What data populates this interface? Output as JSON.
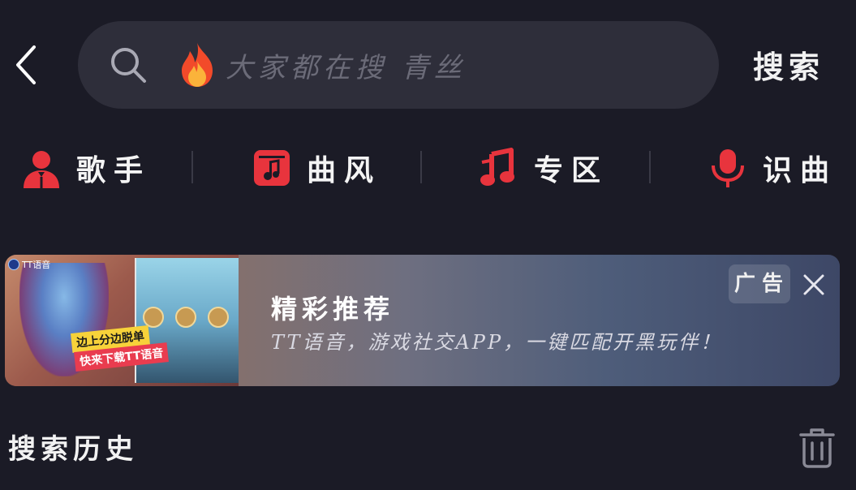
{
  "header": {
    "search_placeholder_prefix": "大家都在搜",
    "search_placeholder_keyword": "青丝",
    "search_button_label": "搜索",
    "icons": {
      "back": "chevron-left-icon",
      "search": "search-icon",
      "hot": "fire-icon"
    }
  },
  "categories": [
    {
      "label": "歌手",
      "icon": "singer-icon"
    },
    {
      "label": "曲风",
      "icon": "music-style-icon"
    },
    {
      "label": "专区",
      "icon": "music-note-icon"
    },
    {
      "label": "识曲",
      "icon": "microphone-icon"
    }
  ],
  "ad": {
    "title": "精彩推荐",
    "subtitle": "TT语音，游戏社交APP，一键匹配开黑玩伴！",
    "tag": "广告",
    "image_brand": "TT语音",
    "image_promo_line1": "边上分边脱单",
    "image_promo_line2": "快来下载TT语音",
    "icons": {
      "close": "close-icon"
    }
  },
  "history": {
    "title": "搜索历史",
    "icons": {
      "clear": "trash-icon"
    }
  },
  "colors": {
    "background": "#1b1b26",
    "search_box": "#2e2e3a",
    "accent_red": "#e8343d",
    "placeholder_text": "#6b6b78"
  }
}
